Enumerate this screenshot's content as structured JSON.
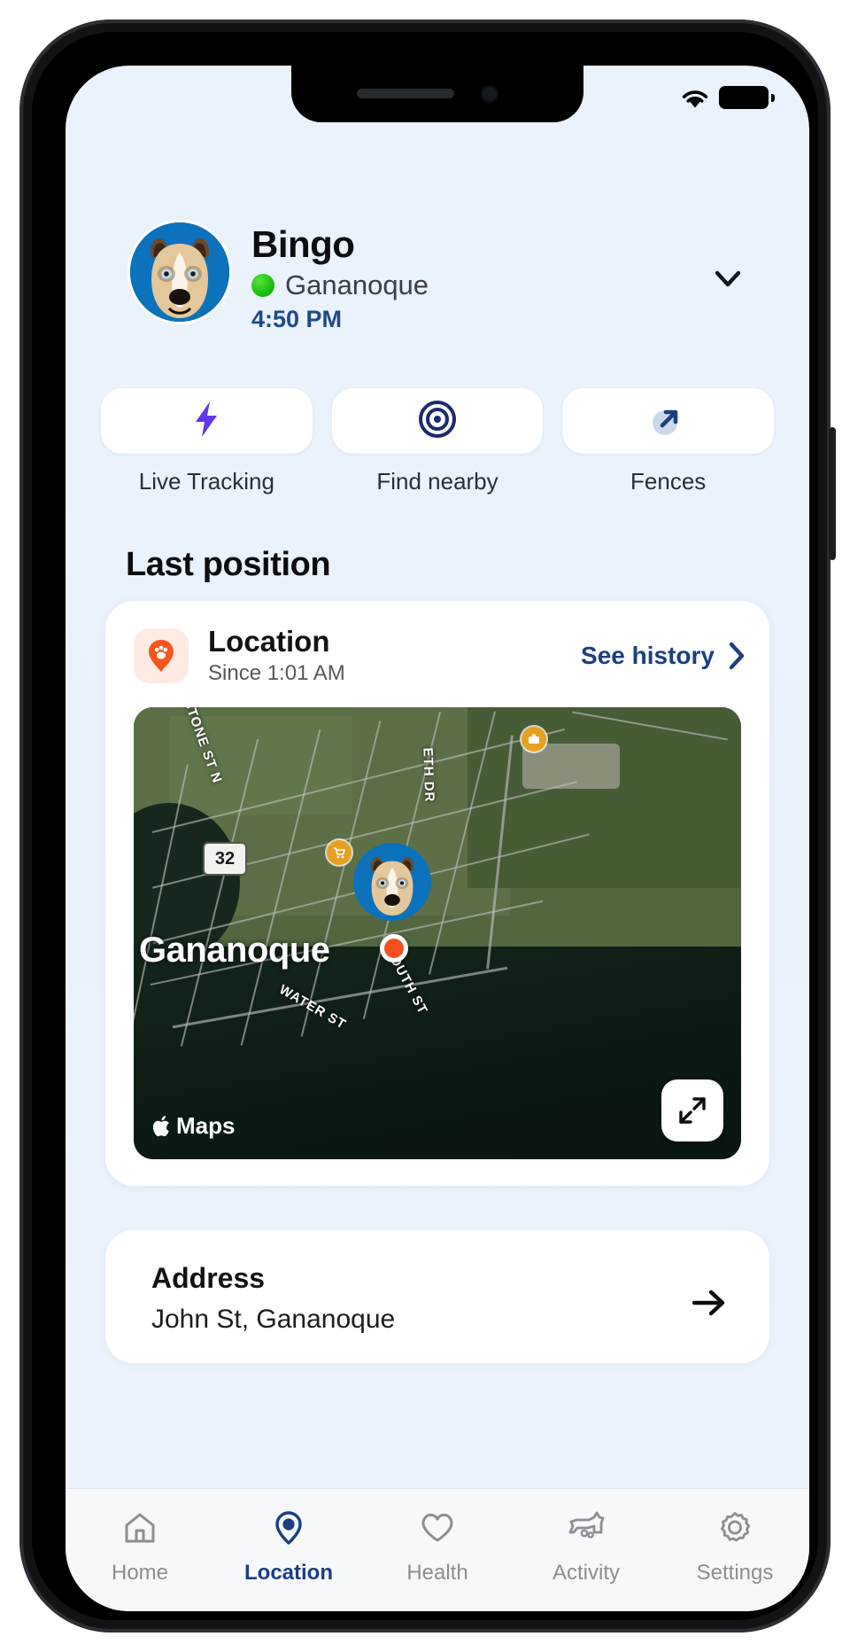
{
  "status_bar": {
    "wifi_icon": "wifi-icon",
    "battery_icon": "battery-icon"
  },
  "header": {
    "pet_name": "Bingo",
    "status_dot_color": "#16b80a",
    "city": "Gananoque",
    "time": "4:50 PM",
    "chevron_icon": "chevron-down-icon",
    "avatar_icon": "dog-avatar"
  },
  "quick_actions": [
    {
      "label": "Live Tracking",
      "icon": "lightning-bolt-icon",
      "color": "#6137e8"
    },
    {
      "label": "Find nearby",
      "icon": "target-icon",
      "color": "#1a2a6e"
    },
    {
      "label": "Fences",
      "icon": "expand-arrow-icon",
      "color": "#1b3f80"
    }
  ],
  "section": {
    "last_position_title": "Last position"
  },
  "location_card": {
    "icon": "paw-pin-icon",
    "title": "Location",
    "subtitle": "Since 1:01 AM",
    "see_history_label": "See history",
    "see_history_chevron": "chevron-right-icon",
    "map": {
      "city_label": "Gananoque",
      "attribution": "Maps",
      "attribution_icon": "apple-logo-icon",
      "expand_icon": "expand-diagonal-icon",
      "route_badge": "32",
      "street_labels": [
        "STONE ST N",
        "ETH DR",
        "SOUTH ST",
        "WATER ST"
      ],
      "pet_marker_icon": "dog-avatar",
      "position_dot_color": "#f3521f"
    }
  },
  "address_card": {
    "title": "Address",
    "value": "John St, Gananoque",
    "arrow_icon": "arrow-right-icon"
  },
  "bottom_nav": {
    "active_color": "#1b3f80",
    "items": [
      {
        "label": "Home",
        "icon": "home-icon",
        "active": false
      },
      {
        "label": "Location",
        "icon": "map-pin-icon",
        "active": true
      },
      {
        "label": "Health",
        "icon": "heart-icon",
        "active": false
      },
      {
        "label": "Activity",
        "icon": "dog-icon",
        "active": false
      },
      {
        "label": "Settings",
        "icon": "gear-icon",
        "active": false
      }
    ]
  }
}
